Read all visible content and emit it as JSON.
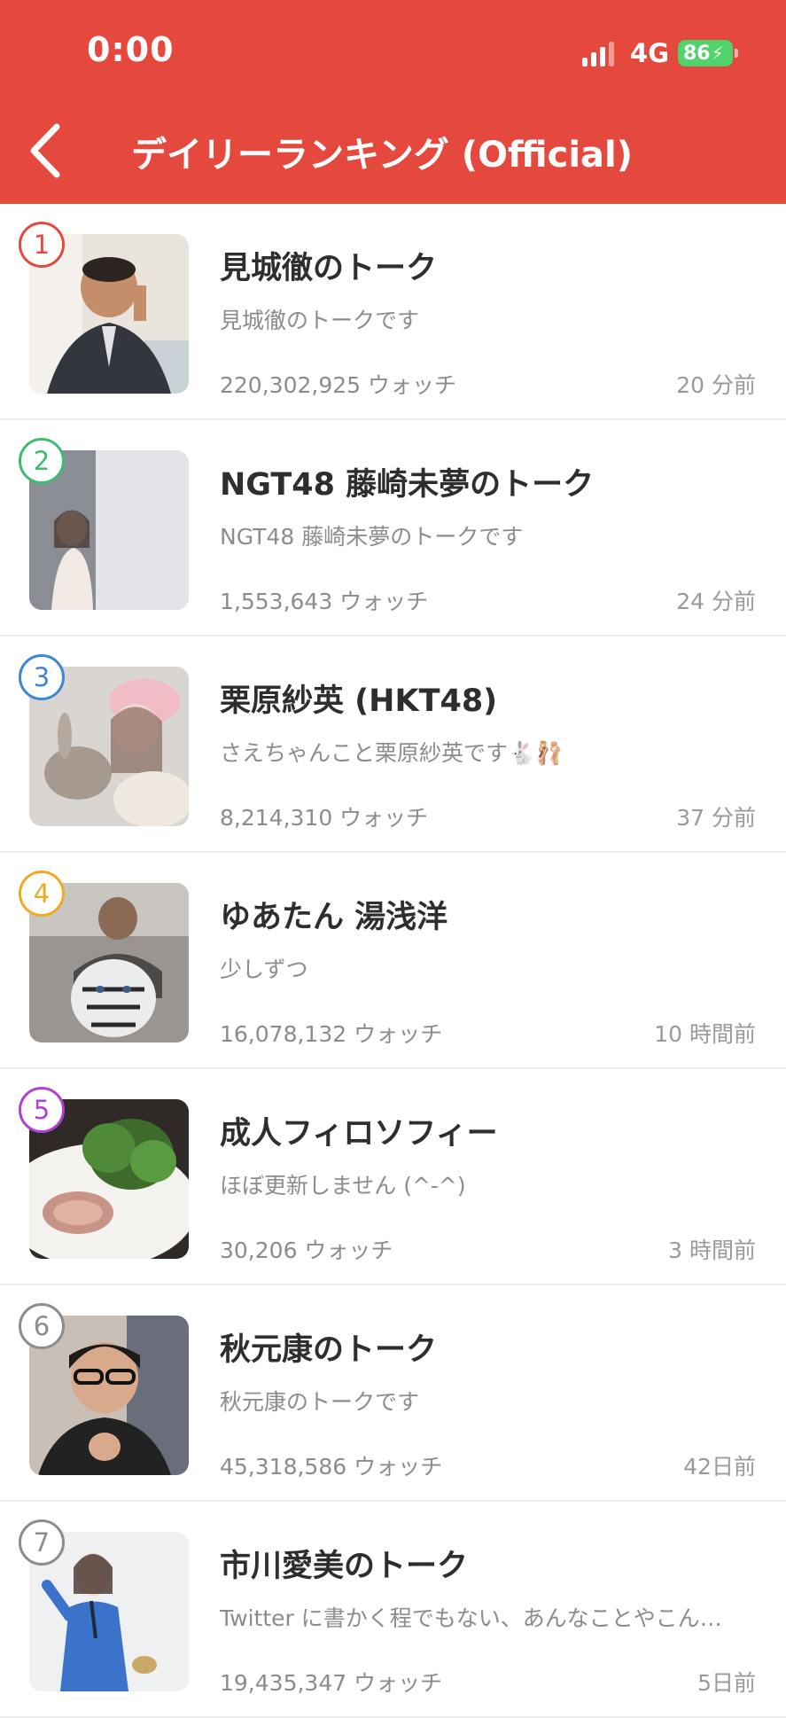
{
  "status_bar": {
    "time": "0:00",
    "network": "4G",
    "battery": "86"
  },
  "header": {
    "title": "デイリーランキング (Official)",
    "back_icon": "chevron-left-icon"
  },
  "colors": {
    "header_bg": "#e5493e",
    "rank_colors": [
      "#e5493e",
      "#3dbb72",
      "#3f86d6",
      "#efaa20",
      "#b140d4",
      "#8c8c8c",
      "#8c8c8c"
    ]
  },
  "rankings": [
    {
      "rank": "1",
      "name": "見城徹のトーク",
      "desc": "見城徹のトークです",
      "watch": "220,302,925 ウォッチ",
      "time": "20 分前"
    },
    {
      "rank": "2",
      "name": "NGT48 藤崎未夢のトーク",
      "desc": "NGT48 藤崎未夢のトークです",
      "watch": "1,553,643 ウォッチ",
      "time": "24 分前"
    },
    {
      "rank": "3",
      "name": "栗原紗英 (HKT48)",
      "desc": "さえちゃんこと栗原紗英です🐇🩰",
      "watch": "8,214,310 ウォッチ",
      "time": "37 分前"
    },
    {
      "rank": "4",
      "name": "ゆあたん 湯浅洋",
      "desc": "少しずつ",
      "watch": "16,078,132 ウォッチ",
      "time": "10 時間前"
    },
    {
      "rank": "5",
      "name": "成人フィロソフィー",
      "desc": "ほぼ更新しません (^-^)",
      "watch": "30,206 ウォッチ",
      "time": "3 時間前"
    },
    {
      "rank": "6",
      "name": "秋元康のトーク",
      "desc": "秋元康のトークです",
      "watch": "45,318,586 ウォッチ",
      "time": "42日前"
    },
    {
      "rank": "7",
      "name": "市川愛美のトーク",
      "desc": "Twitter に書かく程でもない、あんなことやこん…",
      "watch": "19,435,347 ウォッチ",
      "time": "5日前"
    }
  ]
}
